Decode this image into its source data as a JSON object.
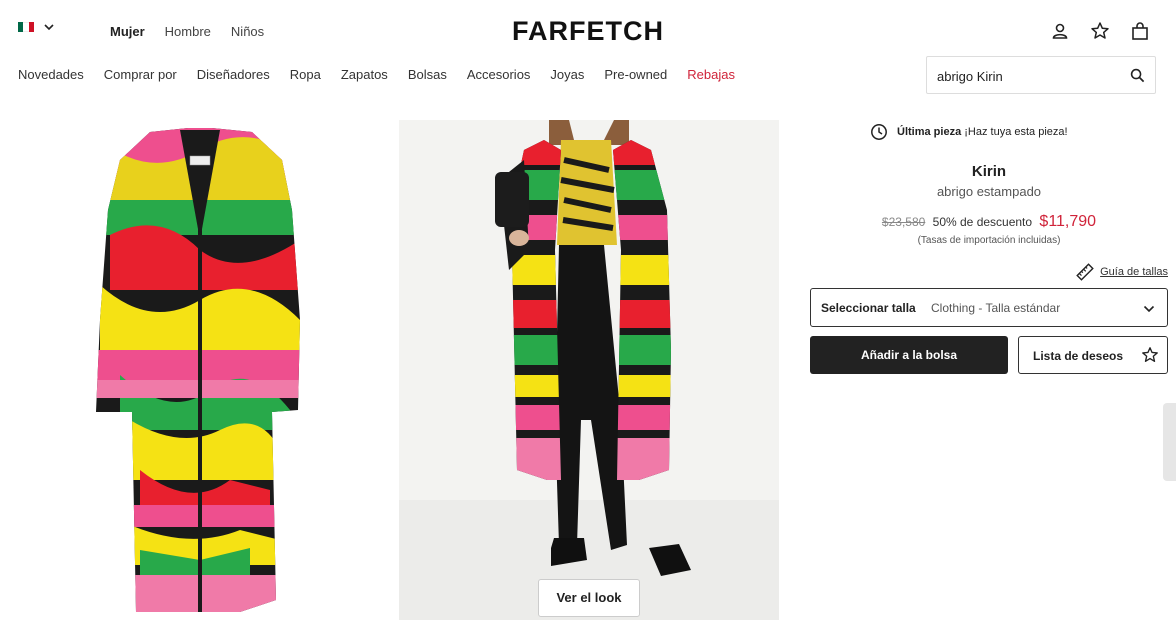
{
  "header": {
    "locale": {
      "flag_colors": [
        "#006847",
        "#ffffff",
        "#ce1126"
      ]
    },
    "gender_tabs": [
      "Mujer",
      "Hombre",
      "Niños"
    ],
    "logo": "FARFETCH",
    "icons": [
      "account-icon",
      "star-icon",
      "bag-icon"
    ]
  },
  "nav": {
    "categories": [
      "Novedades",
      "Comprar por",
      "Diseñadores",
      "Ropa",
      "Zapatos",
      "Bolsas",
      "Accesorios",
      "Joyas",
      "Pre-owned"
    ],
    "sale": "Rebajas"
  },
  "search": {
    "value": "abrigo Kirin"
  },
  "gallery": {
    "look_button": "Ver el look"
  },
  "product": {
    "stock_strong": "Última pieza",
    "stock_text": "¡Haz tuya esta pieza!",
    "brand": "Kirin",
    "description": "abrigo estampado",
    "price_old": "$23,580",
    "discount": "50% de descuento",
    "price_now": "$11,790",
    "tax_note": "(Tasas de importación incluidas)",
    "size_guide": "Guía de tallas",
    "size_select_label": "Seleccionar talla",
    "size_select_value": "Clothing - Talla estándar",
    "add_to_bag": "Añadir a la bolsa",
    "wishlist": "Lista de deseos"
  },
  "colors": {
    "accent_sale": "#d0243a",
    "primary_button": "#222222"
  }
}
